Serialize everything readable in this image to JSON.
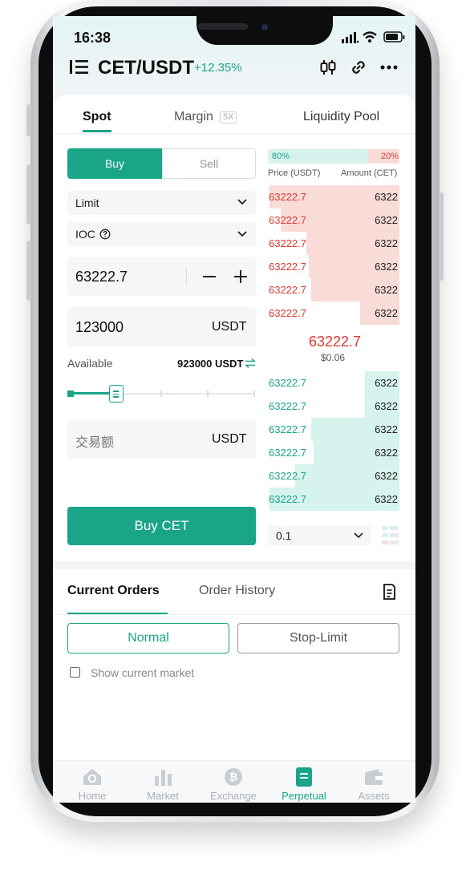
{
  "status_bar": {
    "time": "16:38"
  },
  "header": {
    "pair": "CET/USDT",
    "change": "+12.35%"
  },
  "trade_tabs": [
    {
      "label": "Spot"
    },
    {
      "label": "Margin",
      "badge": "5X"
    },
    {
      "label": "Liquidity Pool"
    }
  ],
  "order_form": {
    "buy_label": "Buy",
    "sell_label": "Sell",
    "order_type": "Limit",
    "time_in_force": "IOC",
    "price": "63222.7",
    "amount": "123000",
    "amount_unit": "USDT",
    "available_label": "Available",
    "available_value": "923000 USDT",
    "slider_percent": 25,
    "total_placeholder": "交易额",
    "total_unit": "USDT",
    "submit_label": "Buy CET"
  },
  "order_book": {
    "buy_ratio": "80%",
    "sell_ratio": "20%",
    "price_header": "Price (USDT)",
    "amount_header": "Amount (CET)",
    "asks": [
      {
        "price": "63222.7",
        "amount": "6322",
        "depth": 0.99
      },
      {
        "price": "63222.7",
        "amount": "6322",
        "depth": 0.9
      },
      {
        "price": "63222.7",
        "amount": "6322",
        "depth": 0.71
      },
      {
        "price": "63222.7",
        "amount": "6322",
        "depth": 0.69
      },
      {
        "price": "63222.7",
        "amount": "6322",
        "depth": 0.67
      },
      {
        "price": "63222.7",
        "amount": "6322",
        "depth": 0.3
      }
    ],
    "last_price": "63222.7",
    "last_price_fiat": "$0.06",
    "bids": [
      {
        "price": "63222.7",
        "amount": "6322",
        "depth": 0.26
      },
      {
        "price": "63222.7",
        "amount": "6322",
        "depth": 0.26
      },
      {
        "price": "63222.7",
        "amount": "6322",
        "depth": 0.67
      },
      {
        "price": "63222.7",
        "amount": "6322",
        "depth": 0.65
      },
      {
        "price": "63222.7",
        "amount": "6322",
        "depth": 0.79
      },
      {
        "price": "63222.7",
        "amount": "6322",
        "depth": 0.99
      }
    ],
    "precision": "0.1"
  },
  "orders_section": {
    "tabs": [
      "Current Orders",
      "Order History"
    ],
    "filter_normal": "Normal",
    "filter_stop": "Stop-Limit",
    "show_current_market": "Show current market"
  },
  "bottom_nav": [
    {
      "label": "Home",
      "icon": "home-icon"
    },
    {
      "label": "Market",
      "icon": "market-icon"
    },
    {
      "label": "Exchange",
      "icon": "exchange-icon"
    },
    {
      "label": "Perpetual",
      "icon": "perpetual-icon"
    },
    {
      "label": "Assets",
      "icon": "assets-icon"
    }
  ],
  "colors": {
    "accent": "#1aa589",
    "sell": "#dc3b34",
    "ask_bg": "#f9dcd8",
    "bid_bg": "#d6f3ee"
  }
}
